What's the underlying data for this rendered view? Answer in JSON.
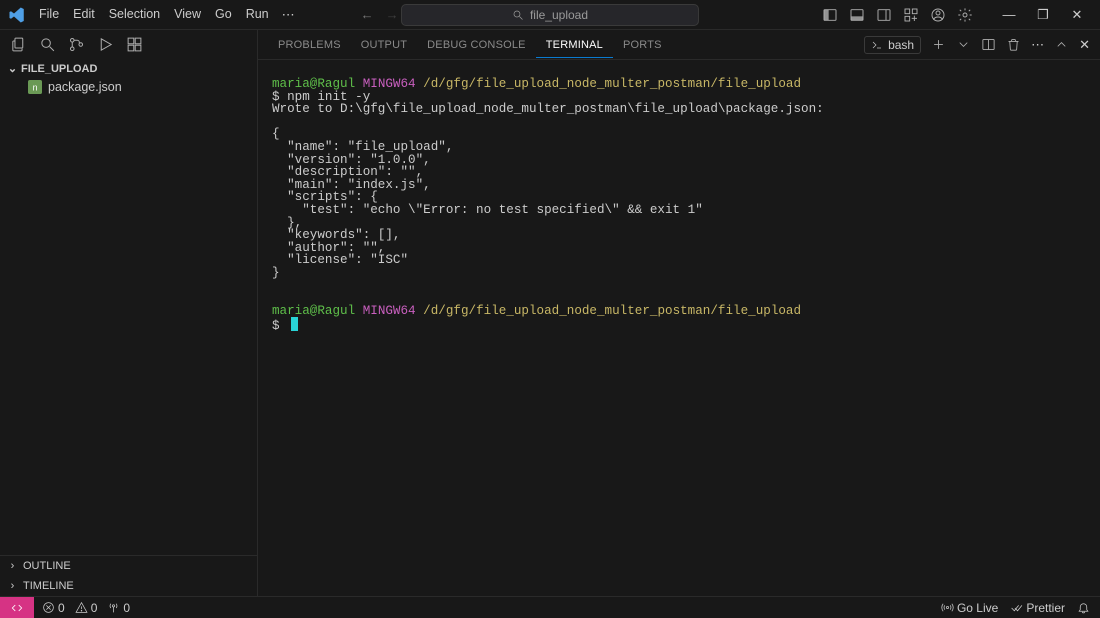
{
  "menu": {
    "items": [
      "File",
      "Edit",
      "Selection",
      "View",
      "Go",
      "Run"
    ]
  },
  "search": {
    "text": "file_upload"
  },
  "explorer": {
    "title": "FILE_UPLOAD",
    "files": [
      {
        "name": "package.json"
      }
    ],
    "collapsed": [
      "OUTLINE",
      "TIMELINE"
    ]
  },
  "panel": {
    "tabs": [
      "PROBLEMS",
      "OUTPUT",
      "DEBUG CONSOLE",
      "TERMINAL",
      "PORTS"
    ],
    "active": 3,
    "shell": "bash"
  },
  "terminal": {
    "user": "maria@Ragul",
    "host": "MINGW64",
    "path": "/d/gfg/file_upload_node_multer_postman/file_upload",
    "cmd": "$ npm init -y",
    "output": "Wrote to D:\\gfg\\file_upload_node_multer_postman\\file_upload\\package.json:\n\n{\n  \"name\": \"file_upload\",\n  \"version\": \"1.0.0\",\n  \"description\": \"\",\n  \"main\": \"index.js\",\n  \"scripts\": {\n    \"test\": \"echo \\\"Error: no test specified\\\" && exit 1\"\n  },\n  \"keywords\": [],\n  \"author\": \"\",\n  \"license\": \"ISC\"\n}",
    "prompt2": "$ "
  },
  "status": {
    "errors": "0",
    "warnings": "0",
    "ports": "0",
    "golive": "Go Live",
    "prettier": "Prettier"
  }
}
